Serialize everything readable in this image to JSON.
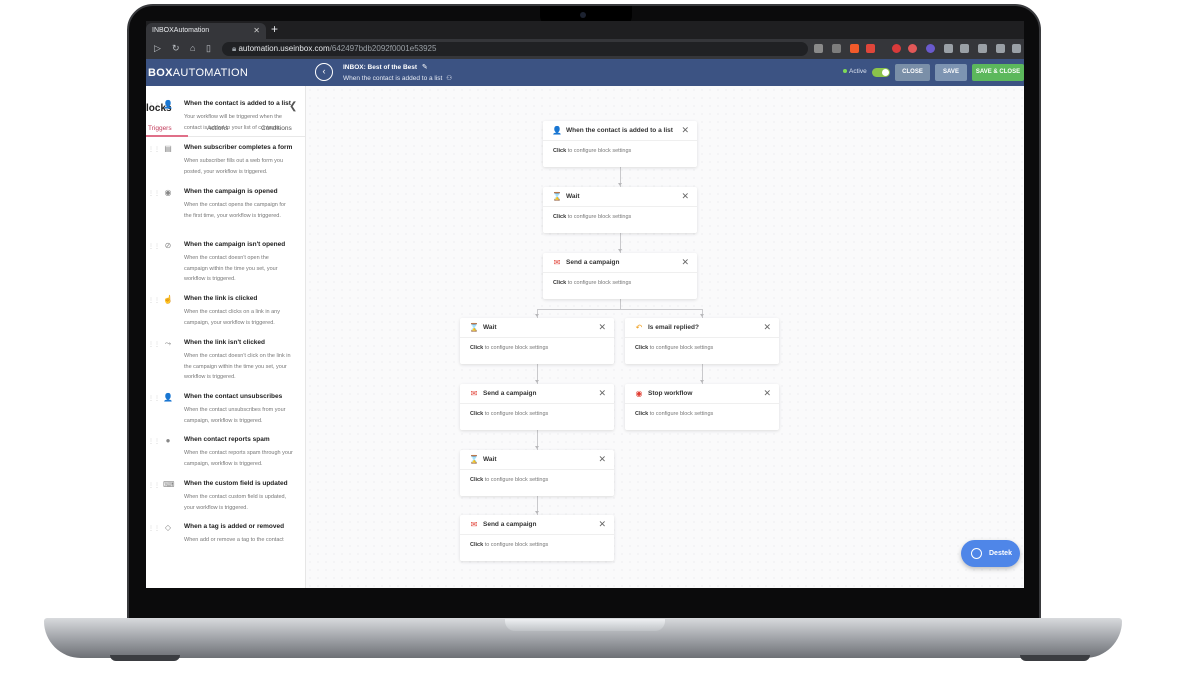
{
  "browser": {
    "tab_title": "INBOXAutomation",
    "tab_close": "✕",
    "new_tab": "+",
    "url_host": "automation.useinbox.com",
    "url_path": "/642497bdb2092f0001e53925"
  },
  "header": {
    "logo_bold": "BOX",
    "logo_rest": "AUTOMATION",
    "back_icon": "‹",
    "workflow_title": "INBOX: Best of the Best",
    "edit_icon": "✎",
    "workflow_subtitle": "When the contact is added to a list",
    "status_label": "Active",
    "close_label": "CLOSE",
    "save_label": "SAVE",
    "save_close_label": "SAVE & CLOSE",
    "colors": {
      "bar": "#3c5383",
      "close": "#7a8fa8",
      "save": "#7d94b2",
      "save_close": "#5cb85c"
    }
  },
  "sidebar": {
    "title": "locks",
    "collapse_icon": "❮",
    "tabs": [
      "Triggers",
      "Actions",
      "Conditions"
    ],
    "items": [
      {
        "icon": "person-add-icon",
        "glyph": "👤",
        "name": "When the contact is added to a list",
        "desc": "Your workflow will be triggered when the contact is added to your list of contacts."
      },
      {
        "icon": "form-icon",
        "glyph": "▤",
        "name": "When subscriber completes a form",
        "desc": "When subscriber fills out a web form you posted, your workflow is triggered."
      },
      {
        "icon": "eye-icon",
        "glyph": "◉",
        "name": "When the campaign is opened",
        "desc": "When the contact opens the campaign for the first time, your workflow is triggered."
      },
      {
        "icon": "eye-off-icon",
        "glyph": "⊘",
        "name": "When the campaign isn't opened",
        "desc": "When the contact doesn't open the campaign within the time you set, your workflow is triggered."
      },
      {
        "icon": "click-icon",
        "glyph": "☝",
        "name": "When the link is clicked",
        "desc": "When the contact clicks on a link in any campaign, your workflow is triggered."
      },
      {
        "icon": "link-off-icon",
        "glyph": "⤳",
        "name": "When the link isn't clicked",
        "desc": "When the contact doesn't click on the link in the campaign within the time you set, your workflow is triggered."
      },
      {
        "icon": "unsubscribe-icon",
        "glyph": "👤",
        "name": "When the contact unsubscribes",
        "desc": "When the contact unsubscribes from your campaign, workflow is triggered."
      },
      {
        "icon": "spam-icon",
        "glyph": "●",
        "name": "When contact reports spam",
        "desc": "When the contact reports spam through your campaign, workflow is triggered."
      },
      {
        "icon": "custom-field-icon",
        "glyph": "⌨",
        "name": "When the custom field is updated",
        "desc": "When the contact custom field is updated, your workflow is triggered."
      },
      {
        "icon": "tag-icon",
        "glyph": "◇",
        "name": "When a tag is added or removed",
        "desc": "When add or remove a tag to the contact"
      }
    ]
  },
  "canvas": {
    "click_word": "Click",
    "configure_text": "to configure block settings",
    "close_glyph": "✕",
    "blocks": [
      {
        "id": "trigger",
        "icon": "person-add-icon",
        "glyph": "👤",
        "color": "#3d6fb6",
        "title": "When the contact is added to a list"
      },
      {
        "id": "wait-1",
        "icon": "hourglass-icon",
        "glyph": "⌛",
        "color": "#e03c31",
        "title": "Wait"
      },
      {
        "id": "send-1",
        "icon": "mail-icon",
        "glyph": "✉",
        "color": "#e03c31",
        "title": "Send a campaign"
      },
      {
        "id": "wait-2",
        "icon": "hourglass-icon",
        "glyph": "⌛",
        "color": "#e03c31",
        "title": "Wait"
      },
      {
        "id": "replied",
        "icon": "reply-icon",
        "glyph": "↶",
        "color": "#f0a020",
        "title": "Is email replied?"
      },
      {
        "id": "send-2",
        "icon": "mail-icon",
        "glyph": "✉",
        "color": "#e03c31",
        "title": "Send a campaign"
      },
      {
        "id": "stop",
        "icon": "stop-icon",
        "glyph": "◉",
        "color": "#e03c31",
        "title": "Stop workflow"
      },
      {
        "id": "wait-3",
        "icon": "hourglass-icon",
        "glyph": "⌛",
        "color": "#e03c31",
        "title": "Wait"
      },
      {
        "id": "send-3",
        "icon": "mail-icon",
        "glyph": "✉",
        "color": "#e03c31",
        "title": "Send a campaign"
      }
    ]
  },
  "help": {
    "label": "Destek"
  }
}
